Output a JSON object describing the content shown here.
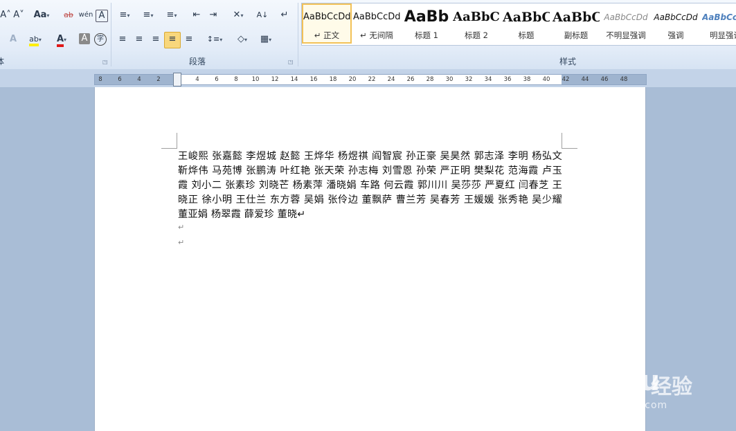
{
  "ribbon": {
    "groups": {
      "font": "体",
      "paragraph": "段落",
      "styles": "样式"
    },
    "font_buttons": {
      "grow": "A˄",
      "shrink": "A˅",
      "case": "Aa",
      "clear_format": "ab",
      "phonetic": "wén",
      "border_char": "A",
      "text_effect": "A",
      "highlight": "ab",
      "font_color": "A",
      "char_shading": "A",
      "enclose_char": "字"
    },
    "paragraph_buttons": {
      "bullets": "≡",
      "numbering": "≡",
      "multilevel": "≡",
      "decrease_indent": "⇤",
      "increase_indent": "⇥",
      "chinese_layout": "✕",
      "sort": "A↓",
      "show_marks": "↵",
      "align_left": "≡",
      "center": "≡",
      "align_right": "≡",
      "justify": "≡",
      "distributed": "≡",
      "line_spacing": "↕≡",
      "shading": "◇",
      "borders": "▦"
    },
    "styles": [
      {
        "sample": "AaBbCcDd",
        "name": "↵ 正文",
        "selected": true
      },
      {
        "sample": "AaBbCcDd",
        "name": "↵ 无间隔",
        "selected": false
      },
      {
        "sample": "AaBb",
        "name": "标题 1",
        "selected": false
      },
      {
        "sample": "AaBbC",
        "name": "标题 2",
        "selected": false
      },
      {
        "sample": "AaBbC",
        "name": "标题",
        "selected": false
      },
      {
        "sample": "AaBbC",
        "name": "副标题",
        "selected": false
      },
      {
        "sample": "AaBbCcDd",
        "name": "不明显强调",
        "selected": false
      },
      {
        "sample": "AaBbCcDd",
        "name": "强调",
        "selected": false
      },
      {
        "sample": "AaBbCcDd",
        "name": "明显强调",
        "selected": false
      }
    ]
  },
  "ruler": {
    "labels": [
      "8",
      "6",
      "4",
      "2",
      "2",
      "4",
      "6",
      "8",
      "10",
      "12",
      "14",
      "16",
      "18",
      "20",
      "22",
      "24",
      "26",
      "28",
      "30",
      "32",
      "34",
      "36",
      "38",
      "40",
      "42",
      "44",
      "46",
      "48"
    ]
  },
  "document": {
    "text": "王峻熙 张嘉懿 李煜城 赵懿 王烨华 杨煜祺 阎智宸 孙正豪 吴昊然 郭志泽 李明  杨弘文 靳烨伟 马苑博 张鹏涛 叶红艳 张天荣 孙志梅 刘雪恩 孙荣 严正明 樊梨花 范海霞 卢玉霞 刘小二 张素珍 刘晓芒 杨素萍 潘晓娟 车路 何云霞 郭川川 吴莎莎 严夏红 闫春芝 王晓正 徐小明 王仕兰 东方蓉 吴娟 张伶边 董飘萨 曹兰芳 吴春芳 王媛媛 张秀艳 吴少耀 董亚娟 杨翠霞 薛爱珍 董晓↵",
    "empty_paragraph_mark": "↵"
  },
  "watermark": {
    "logo": "Bai du",
    "brand_cn": "经验",
    "site": "jingyan.baidu.com"
  }
}
